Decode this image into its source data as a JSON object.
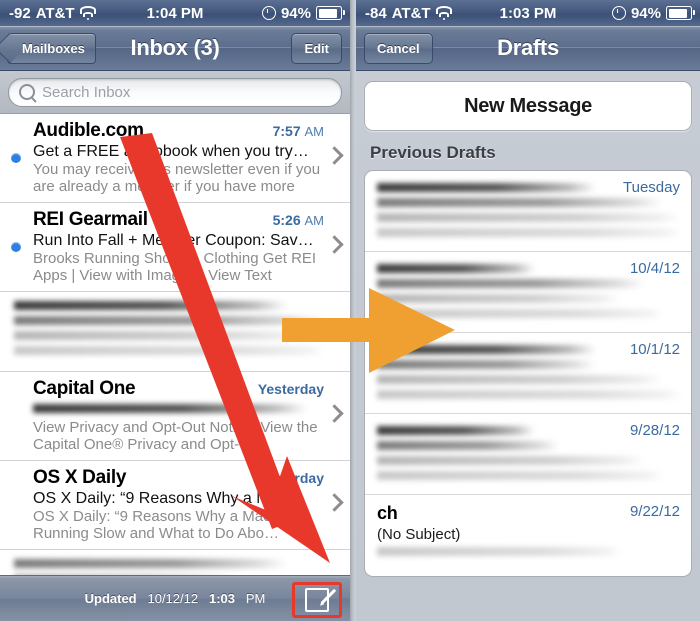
{
  "left_phone": {
    "status_bar": {
      "signal": "-92",
      "carrier": "AT&T",
      "wifi_icon": "wifi-icon",
      "time": "1:04 PM",
      "alarm_icon": "clock-icon",
      "battery_pct": "94%",
      "battery_icon": "battery-icon"
    },
    "nav": {
      "back_label": "Mailboxes",
      "title": "Inbox (3)",
      "edit_label": "Edit"
    },
    "search": {
      "placeholder": "Search Inbox",
      "icon": "search-icon"
    },
    "messages": [
      {
        "redacted": false,
        "sender": "Audible.com",
        "time": "7:57",
        "ampm": "AM",
        "subject": "Get a FREE audiobook when you try…",
        "preview": "You may receive this newsletter even if you are already a member if you have more th…"
      },
      {
        "redacted": false,
        "sender": "REI Gearmail",
        "time": "5:26",
        "ampm": "AM",
        "subject": "Run Into Fall + Member Coupon: Sav…",
        "preview": "Brooks Running Shoes + Clothing Get REI Apps | View with Images | View Text Versi…"
      },
      {
        "redacted": true,
        "sender": "",
        "time": "",
        "ampm": "",
        "subject": "",
        "preview": ""
      },
      {
        "redacted": false,
        "sender": "Capital One",
        "time": "Yesterday",
        "ampm": "",
        "subject": "",
        "subject_redacted": true,
        "preview": "View Privacy and Opt-Out Notice. View the Capital One® Privacy and Opt-Out Notice…"
      },
      {
        "redacted": false,
        "sender": "OS X Daily",
        "time": "Yesterday",
        "ampm": "",
        "subject": "OS X Daily: “9 Reasons Why a M…",
        "preview": "OS X Daily: “9 Reasons Why a Mac is Running Slow and What to Do Abo…"
      }
    ],
    "toolbar": {
      "updated_label": "Updated",
      "updated_date": "10/12/12",
      "updated_time": "1:03",
      "updated_ampm": "PM",
      "compose_icon": "compose-icon"
    }
  },
  "right_phone": {
    "status_bar": {
      "signal": "-84",
      "carrier": "AT&T",
      "wifi_icon": "wifi-icon",
      "time": "1:03 PM",
      "alarm_icon": "clock-icon",
      "battery_pct": "94%",
      "battery_icon": "battery-icon"
    },
    "nav": {
      "cancel_label": "Cancel",
      "title": "Drafts"
    },
    "new_message_label": "New Message",
    "section_title": "Previous Drafts",
    "drafts": [
      {
        "redacted": true,
        "date": "Tuesday",
        "sender": "",
        "subject": "",
        "preview": ""
      },
      {
        "redacted": true,
        "date": "10/4/12",
        "sender": "",
        "subject": "",
        "preview": ""
      },
      {
        "redacted": true,
        "date": "10/1/12",
        "sender": "",
        "subject": "",
        "preview": ""
      },
      {
        "redacted": true,
        "date": "9/28/12",
        "sender": "",
        "subject": "",
        "preview": ""
      },
      {
        "redacted": false,
        "date": "9/22/12",
        "sender": "ch",
        "subject": "(No Subject)",
        "preview": ""
      }
    ]
  },
  "annotations": {
    "red_arrow": {
      "name": "red-annotation-arrow",
      "color": "#E8382B",
      "points_to": "compose-button"
    },
    "orange_arrow": {
      "name": "orange-annotation-arrow",
      "color": "#F0A030",
      "points_to": "drafts-list"
    },
    "compose_highlight_color": "#E8382B"
  }
}
